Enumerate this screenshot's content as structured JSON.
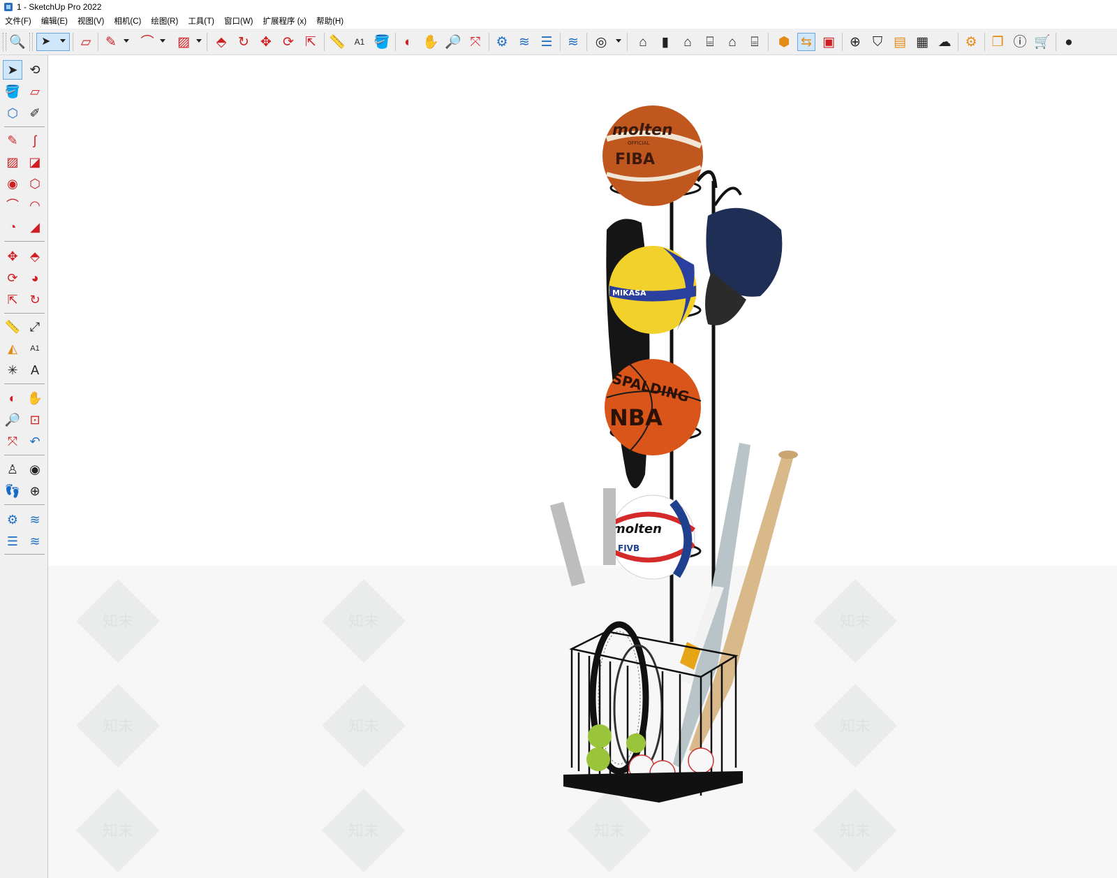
{
  "window": {
    "title": "1 - SketchUp Pro 2022"
  },
  "menu": [
    "文件(F)",
    "编辑(E)",
    "视图(V)",
    "相机(C)",
    "绘图(R)",
    "工具(T)",
    "窗口(W)",
    "扩展程序 (x)",
    "帮助(H)"
  ],
  "toolbar": {
    "icons": [
      "search-icon",
      "select-icon",
      "eraser-icon",
      "pencil-icon",
      "arc-icon",
      "rectangle-icon",
      "push-pull-icon",
      "follow-me-icon",
      "move-icon",
      "rotate-icon",
      "scale-icon",
      "tape-measure-icon",
      "text-icon",
      "paint-bucket-icon",
      "orbit-icon",
      "pan-icon",
      "zoom-icon",
      "zoom-extents-icon",
      "sandbox-icon",
      "section-icon",
      "layers-icon",
      "style-icon",
      "user-icon",
      "warehouse-icon",
      "components-icon",
      "house-icon",
      "shed-icon",
      "home-outline-icon",
      "store-icon",
      "model-info-icon",
      "outliner-icon",
      "scenes-icon",
      "add-icon",
      "shield-icon",
      "reports-icon",
      "checker-icon",
      "cloud-icon",
      "settings-icon",
      "chat-icon",
      "info-icon",
      "cart-icon",
      "account-icon"
    ]
  },
  "lefttoolbar": {
    "icons": [
      "select-icon",
      "orbit-icon",
      "paint-bucket-icon",
      "eraser-icon",
      "component-icon",
      "tag-icon",
      "pencil-icon",
      "freehand-icon",
      "rectangle-icon",
      "rotated-rect-icon",
      "circle-icon",
      "polygon-icon",
      "arc-icon",
      "two-point-arc-icon",
      "pie-icon",
      "three-point-arc-icon",
      "move-icon",
      "push-pull-icon",
      "rotate-icon",
      "follow-me-icon",
      "scale-icon",
      "offset-icon",
      "tape-measure-icon",
      "dimension-icon",
      "protractor-icon",
      "text-icon",
      "axes-icon",
      "3d-text-icon",
      "orbit-alt-icon",
      "pan-icon",
      "zoom-icon",
      "zoom-window-icon",
      "zoom-extents-icon",
      "previous-view-icon",
      "position-camera-icon",
      "look-around-icon",
      "walk-icon",
      "section-plane-icon",
      "sandbox-icon",
      "smoove-icon",
      "stamp-icon",
      "drape-icon"
    ]
  },
  "scene": {
    "ball_labels": {
      "basketball_top_brand": "molten",
      "basketball_top_official": "OFFICIAL",
      "basketball_top_fiba": "FIBA",
      "volleyball_brand": "MIKASA",
      "basketball_mid_brand": "SPALDING",
      "basketball_mid_league": "NBA",
      "volleyball_bottom_brand": "molten",
      "volleyball_bottom_fivb": "FIVB"
    },
    "watermark": "知末",
    "colors": {
      "basketball": "#c0571f",
      "basketball_nba": "#d9551a",
      "volleyball_yellow": "#f2d22a",
      "volleyball_blue": "#2b3f9e",
      "cap": "#1f2e55",
      "bat_wood": "#d9b98a",
      "rack": "#111111",
      "floor": "#f6f7f6"
    }
  }
}
